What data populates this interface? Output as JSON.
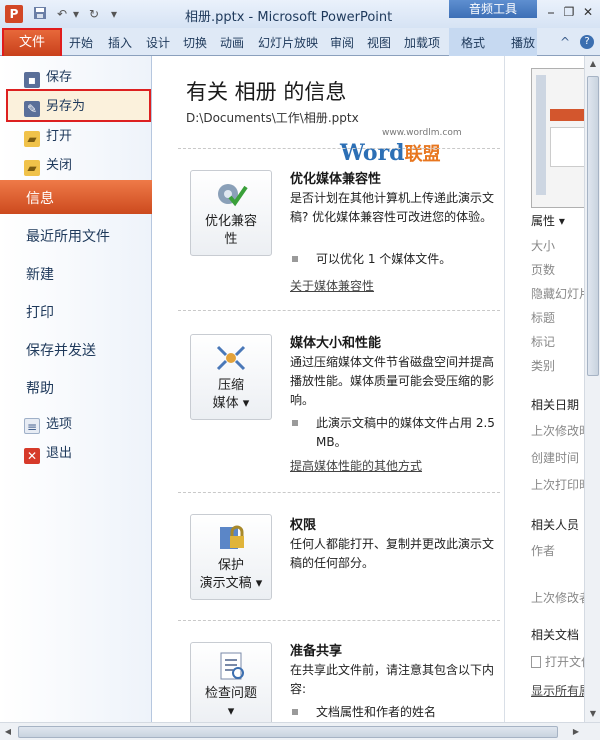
{
  "window": {
    "title": "相册.pptx - Microsoft PowerPoint",
    "app_icon_label": "P",
    "context_tab_group": "音频工具",
    "controls": {
      "minimize": "⎯",
      "restore": "❐",
      "close": "✕"
    }
  },
  "quick_access": {
    "save_icon": "save-icon",
    "undo": "↶",
    "redo": "↻",
    "customize": "▾"
  },
  "ribbon": {
    "file_tab": "文件",
    "tabs": [
      "开始",
      "插入",
      "设计",
      "切换",
      "动画",
      "幻灯片放映",
      "审阅",
      "视图",
      "加载项"
    ],
    "context_tabs": [
      "格式",
      "播放"
    ],
    "collapse_icon": "^",
    "help_icon": "?"
  },
  "backstage_nav": {
    "small_items_top": [
      {
        "label": "保存",
        "icon": "save-icon"
      },
      {
        "label": "另存为",
        "icon": "save-as-icon"
      },
      {
        "label": "打开",
        "icon": "open-folder-icon"
      },
      {
        "label": "关闭",
        "icon": "close-file-icon"
      }
    ],
    "big_items": [
      "信息",
      "最近所用文件",
      "新建",
      "打印",
      "保存并发送",
      "帮助"
    ],
    "small_items_bottom": [
      {
        "label": "选项",
        "icon": "options-icon"
      },
      {
        "label": "退出",
        "icon": "exit-icon"
      }
    ],
    "selected": "信息"
  },
  "info": {
    "title": "有关 相册 的信息",
    "path": "D:\\Documents\\工作\\相册.pptx",
    "watermark_url": "www.wordlm.com",
    "watermark_word": "Word",
    "watermark_cn": "联盟",
    "sections": [
      {
        "button_lines": [
          "优化兼容",
          "性"
        ],
        "button_icon": "optimize-compatibility-icon",
        "title": "优化媒体兼容性",
        "desc": "是否计划在其他计算机上传递此演示文稿? 优化媒体兼容性可改进您的体验。",
        "bullet": "可以优化 1 个媒体文件。",
        "link": "关于媒体兼容性"
      },
      {
        "button_lines": [
          "压缩",
          "媒体 ▾"
        ],
        "button_icon": "compress-media-icon",
        "title": "媒体大小和性能",
        "desc": "通过压缩媒体文件节省磁盘空间并提高播放性能。媒体质量可能会受压缩的影响。",
        "bullet": "此演示文稿中的媒体文件占用 2.5 MB。",
        "link": "提高媒体性能的其他方式"
      },
      {
        "button_lines": [
          "保护",
          "演示文稿 ▾"
        ],
        "button_icon": "protect-lock-icon",
        "title": "权限",
        "desc": "任何人都能打开、复制并更改此演示文稿的任何部分。",
        "bullet": "",
        "link": ""
      },
      {
        "button_lines": [
          "检查问题",
          "▾"
        ],
        "button_icon": "check-issues-icon",
        "title": "准备共享",
        "desc": "在共享此文件前，请注意其包含以下内容:",
        "bullet": "文档属性和作者的姓名",
        "link": ""
      }
    ]
  },
  "properties": {
    "header": "属性 ▾",
    "fields": [
      "大小",
      "页数",
      "隐藏幻灯片",
      "标题",
      "标记",
      "类别"
    ],
    "related_dates_header": "相关日期",
    "dates": [
      "上次修改时间",
      "创建时间",
      "上次打印时间"
    ],
    "related_people_header": "相关人员",
    "people": [
      "作者",
      "上次修改者"
    ],
    "related_docs_header": "相关文档",
    "open_location": "打开文件位置",
    "show_all": "显示所有属性"
  },
  "colors": {
    "file_tab": "#d04f24",
    "highlight_box": "#dd2020",
    "selected_nav": "#e2673a",
    "link_blue": "#2c6fb5"
  }
}
